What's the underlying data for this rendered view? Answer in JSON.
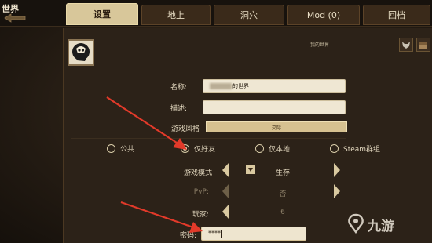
{
  "header": {
    "world_label": "世界"
  },
  "tabs": [
    {
      "label": "设置",
      "active": true
    },
    {
      "label": "地上"
    },
    {
      "label": "洞穴"
    },
    {
      "label": "Mod (0)"
    },
    {
      "label": "回档"
    }
  ],
  "server": {
    "title": "我的世界"
  },
  "form": {
    "name_label": "名称:",
    "name_value": "的世界",
    "desc_label": "描述:",
    "desc_value": "",
    "style_label": "游戏风格",
    "style_value": "交际",
    "privacy": [
      {
        "label": "公共",
        "selected": false
      },
      {
        "label": "仅好友",
        "selected": true
      },
      {
        "label": "仅本地",
        "selected": false
      },
      {
        "label": "Steam群组",
        "selected": false
      }
    ],
    "mode_label": "游戏模式",
    "mode_value": "生存",
    "pvp_label": "PvP:",
    "pvp_value": "否",
    "players_label": "玩家:",
    "players_value": "6",
    "password_label": "密码:",
    "password_value": "****"
  },
  "watermark": {
    "text": "九游"
  },
  "colors": {
    "accent": "#d8c79a",
    "arrow": "#e23a2a",
    "panel": "#2c2218"
  }
}
